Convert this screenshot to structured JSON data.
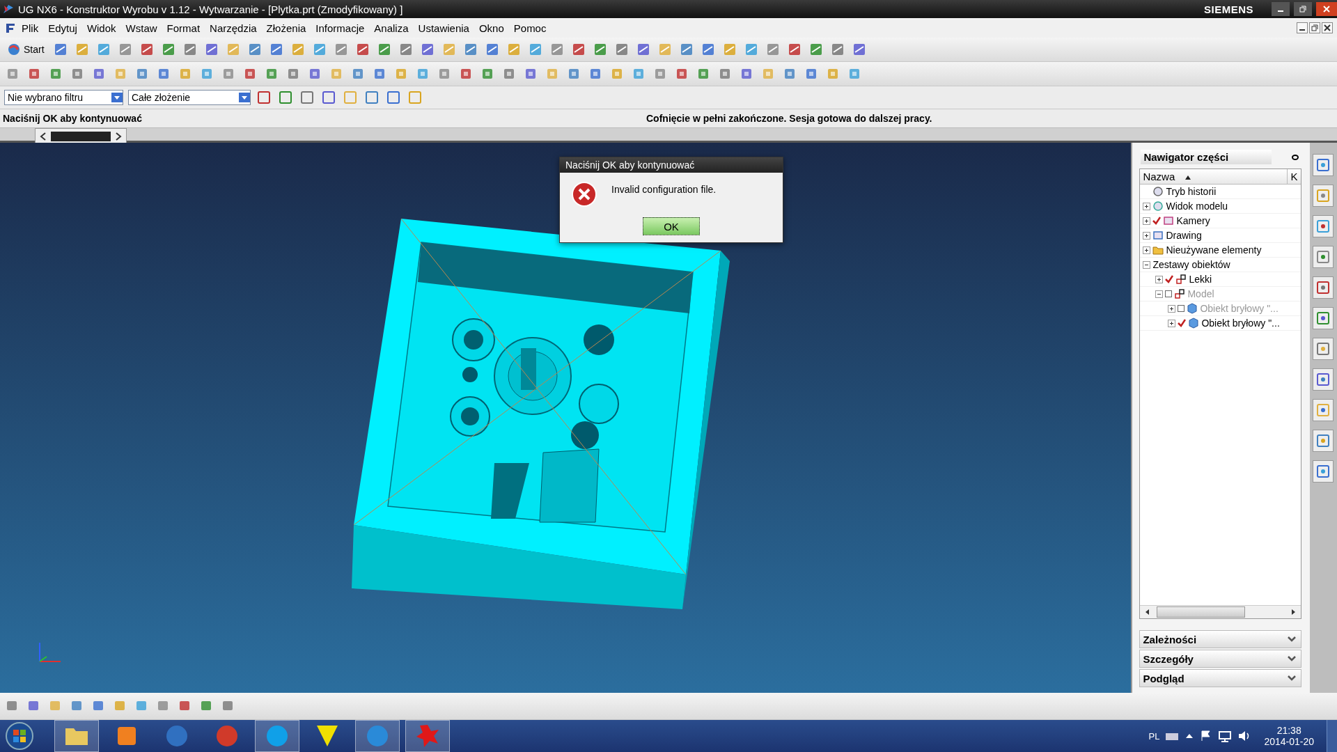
{
  "window": {
    "title": "UG NX6 - Konstruktor Wyrobu v 1.12 - Wytwarzanie - [Plytka.prt (Zmodyfikowany) ]",
    "brand": "SIEMENS"
  },
  "menu": [
    "Plik",
    "Edytuj",
    "Widok",
    "Wstaw",
    "Format",
    "Narzędzia",
    "Złożenia",
    "Informacje",
    "Analiza",
    "Ustawienia",
    "Okno",
    "Pomoc"
  ],
  "toolbar": {
    "start_label": "Start"
  },
  "selection_bar": {
    "filter": "Nie wybrano filtru",
    "scope": "Całe złożenie"
  },
  "status": {
    "prompt": "Naciśnij OK aby kontynuować",
    "message": "Cofnięcie w pełni zakończone. Sesja gotowa do dalszej pracy."
  },
  "dialog": {
    "title": "Naciśnij OK aby kontynuować",
    "message": "Invalid configuration file.",
    "button": "OK"
  },
  "navigator": {
    "title": "Nawigator części",
    "columns": [
      "Nazwa",
      "K"
    ],
    "tree": [
      {
        "label": "Tryb historii",
        "kind": "clock"
      },
      {
        "label": "Widok modelu",
        "kind": "view",
        "expanded": false
      },
      {
        "label": "Kamery",
        "kind": "camera",
        "expanded": false,
        "checked": true
      },
      {
        "label": "Drawing",
        "kind": "drawing",
        "expanded": false
      },
      {
        "label": "Nieużywane elementy",
        "kind": "folder",
        "expanded": false
      },
      {
        "label": "Zestawy obiektów",
        "expanded": true,
        "children": [
          {
            "label": "Lekki",
            "kind": "set",
            "expanded": false,
            "checked": true
          },
          {
            "label": "Model",
            "kind": "set",
            "expanded": true,
            "checked": false,
            "dimmed": true,
            "children": [
              {
                "label": "Obiekt bryłowy \"...",
                "kind": "solid",
                "expanded": false,
                "checked": false,
                "dimmed": true
              },
              {
                "label": "Obiekt bryłowy \"...",
                "kind": "solid",
                "expanded": false,
                "checked": true,
                "dimmed": false
              }
            ]
          }
        ]
      }
    ],
    "sections": [
      "Zależności",
      "Szczegóły",
      "Podgląd"
    ]
  },
  "taskbar": {
    "apps": [
      {
        "kind": "folder",
        "open": true
      },
      {
        "kind": "player",
        "open": false
      },
      {
        "kind": "mail",
        "open": false
      },
      {
        "kind": "browser",
        "open": false
      },
      {
        "kind": "skype",
        "open": true
      },
      {
        "kind": "triangle",
        "open": false
      },
      {
        "kind": "nx",
        "open": true
      },
      {
        "kind": "splash",
        "open": true
      }
    ],
    "language": "PL",
    "time": "21:38",
    "date": "2014-01-20"
  }
}
